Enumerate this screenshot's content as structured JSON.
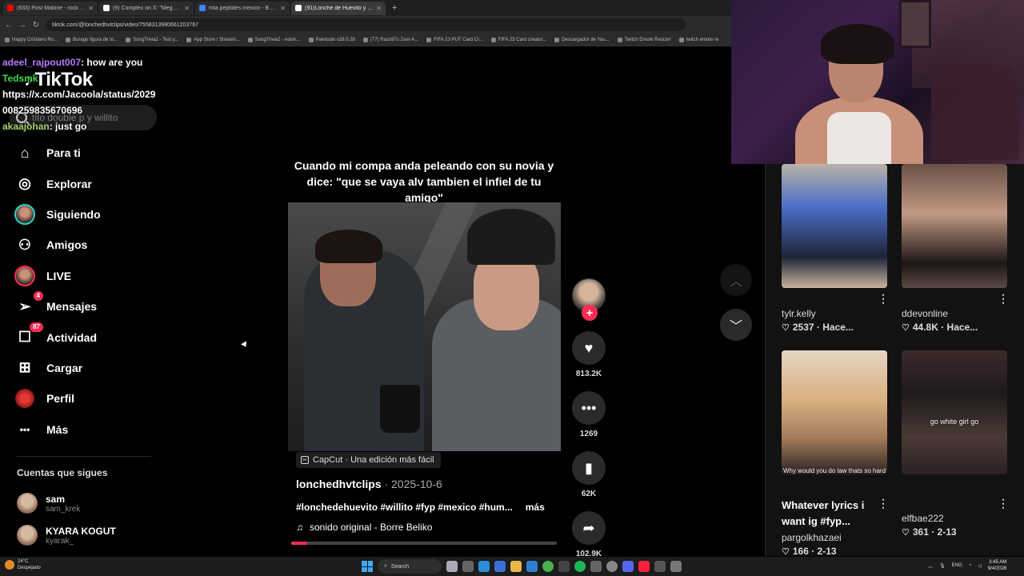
{
  "browser": {
    "tabs": [
      {
        "label": "(633) Post Malone - rockstar ft",
        "color": "#ff0000"
      },
      {
        "label": "(9) Complex on X: \"Megan Fox",
        "color": "#ffffff"
      },
      {
        "label": "mta peptides mexico - Buscar c",
        "color": "#4285f4"
      },
      {
        "label": "(91)Lonche de Huevito y Willit",
        "color": "#ffffff"
      }
    ],
    "new_tab": "+",
    "url": "tiktok.com/@lonchedhvtclips/video/7558313980661203767",
    "bookmarks": [
      "Happy Cristiano Ro...",
      "Burago figura de to...",
      "SongTrivia2 - Test y...",
      "App Store / Streami...",
      "SongTrivia2 - Advin...",
      "Paletools v28.0.28",
      "(77) Razo97s Zest-A...",
      "FIFA 23 PUT Card Cr...",
      "FIFA 23 Card creator...",
      "Descargador de You...",
      "Twitch Emote Resizer",
      "twitch emote re"
    ]
  },
  "chat": [
    {
      "user": "adeel_rajpout007",
      "text": ": how are you",
      "color": "#b57cff"
    },
    {
      "user": "Tedsmk",
      "text": "",
      "color": "#3ddc4a"
    },
    {
      "user": "",
      "text": "https://x.com/Jacoola/status/2029",
      "color": "#ffffff"
    },
    {
      "user": "",
      "text": "008259835670696",
      "color": "#ffffff"
    },
    {
      "user": "akaajohan",
      "text": ": just go",
      "color": "#a9d36a"
    }
  ],
  "tiktok": {
    "logo": "TikTok",
    "search_placeholder": "tito double p y willito",
    "nav": [
      {
        "label": "Para ti",
        "icon": "home-icon",
        "badge": ""
      },
      {
        "label": "Explorar",
        "icon": "compass-icon",
        "badge": ""
      },
      {
        "label": "Siguiendo",
        "icon": "following-avatar-icon",
        "badge": ""
      },
      {
        "label": "Amigos",
        "icon": "friends-icon",
        "badge": ""
      },
      {
        "label": "LIVE",
        "icon": "live-avatar-icon",
        "badge": ""
      },
      {
        "label": "Mensajes",
        "icon": "send-icon",
        "badge": "4"
      },
      {
        "label": "Actividad",
        "icon": "inbox-icon",
        "badge": "87"
      },
      {
        "label": "Cargar",
        "icon": "upload-icon",
        "badge": ""
      },
      {
        "label": "Perfil",
        "icon": "profile-avatar-icon",
        "badge": ""
      },
      {
        "label": "Más",
        "icon": "more-icon",
        "badge": ""
      }
    ],
    "following_title": "Cuentas que sigues",
    "following": [
      {
        "name": "sam",
        "handle": "sam_krek"
      },
      {
        "name": "KYARA KOGUT",
        "handle": "kyarak_"
      }
    ],
    "video": {
      "caption": "Cuando mi compa anda peleando con su novia y dice: \"que se vaya alv tambien el infiel de tu amigo\"",
      "capcut": "CapCut · Una edición más fácil",
      "author": "lonchedhvtclips",
      "date": " · 2025-10-6",
      "tags": "#lonchedehuevito #willito #fyp #mexico #hum...",
      "more": "más",
      "sound": "sonido original - Borre Beliko",
      "progress": 0.06
    },
    "actions": {
      "likes": "813.2K",
      "comments": "1269",
      "saves": "62K",
      "shares": "102.9K"
    },
    "related": [
      {
        "name": "tylr.kelly",
        "stat": "2537 · Hace...",
        "title": ""
      },
      {
        "name": "ddevonline",
        "stat": "44.8K · Hace...",
        "title": ""
      },
      {
        "name": "pargolkhazaei",
        "stat": "166 · 2-13",
        "title": "Whatever lyrics i want ig #fyp...",
        "overlay": "Why would you do law thats so hard"
      },
      {
        "name": "elfbae222",
        "stat": "361 · 2-13",
        "title": "",
        "overlay": "go white girl go"
      }
    ]
  },
  "taskbar": {
    "weather_temp": "24°C",
    "weather_desc": "Despejado",
    "search": "Search",
    "lang": "ENG",
    "time": "3:45 AM",
    "date": "9/4/2026"
  }
}
